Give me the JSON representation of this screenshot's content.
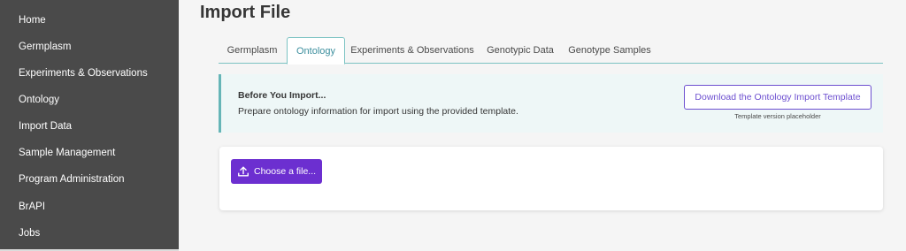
{
  "sidebar": {
    "items": [
      {
        "label": "Home"
      },
      {
        "label": "Germplasm"
      },
      {
        "label": "Experiments & Observations"
      },
      {
        "label": "Ontology"
      },
      {
        "label": "Import Data"
      },
      {
        "label": "Sample Management"
      },
      {
        "label": "Program Administration"
      },
      {
        "label": "BrAPI"
      },
      {
        "label": "Jobs"
      }
    ]
  },
  "main": {
    "title": "Import File",
    "tabs": [
      {
        "label": "Germplasm",
        "active": false
      },
      {
        "label": "Ontology",
        "active": true
      },
      {
        "label": "Experiments & Observations",
        "active": false
      },
      {
        "label": "Genotypic Data",
        "active": false
      },
      {
        "label": "Genotype Samples",
        "active": false
      }
    ],
    "info": {
      "title": "Before You Import...",
      "text": "Prepare ontology information for import using the provided template.",
      "download_label": "Download the Ontology Import Template",
      "template_version": "Template version placeholder"
    },
    "upload": {
      "choose_label": "Choose a file...",
      "icon": "upload-icon"
    }
  },
  "colors": {
    "sidebar_bg": "#4a4a4a",
    "accent_teal": "#7cc3c3",
    "accent_purple": "#6c2fd0"
  }
}
